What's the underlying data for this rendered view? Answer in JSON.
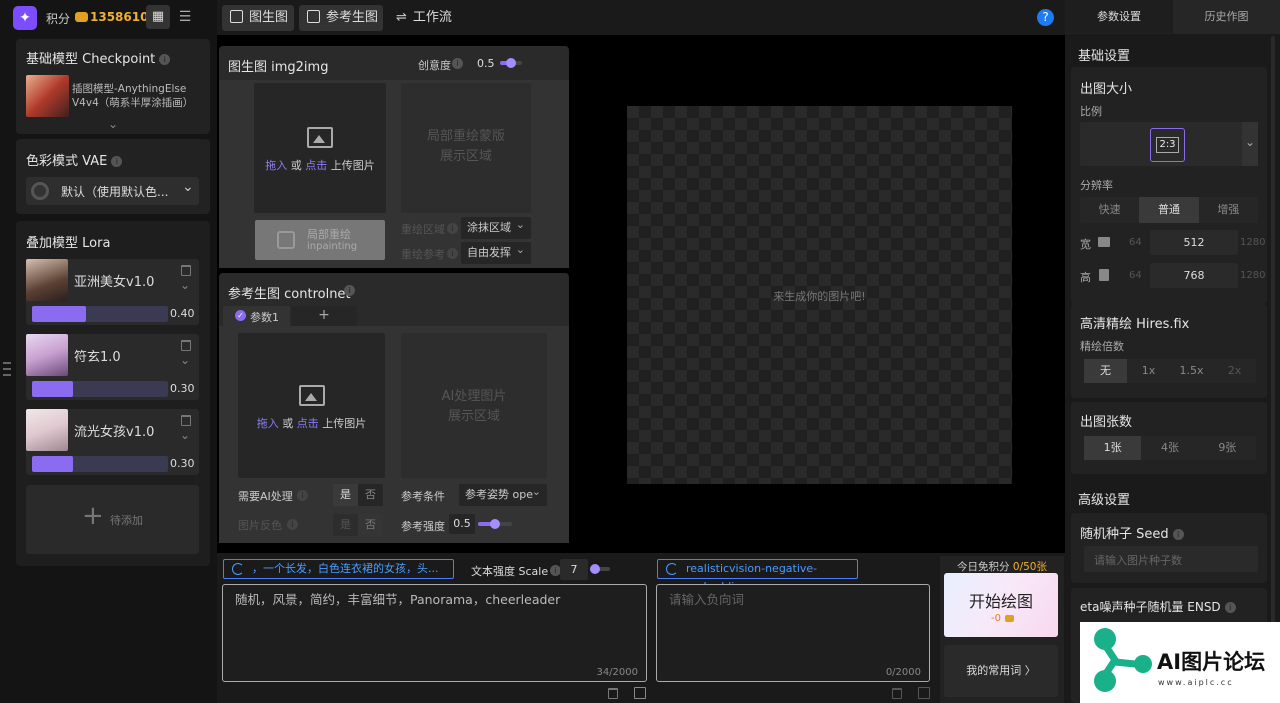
{
  "account": {
    "points_label": "积分",
    "points_value": "1358610"
  },
  "left": {
    "checkpoint_title": "基础模型 Checkpoint",
    "checkpoint_name": "插图模型-AnythingElse V4v4（萌系半厚涂插画）",
    "vae_title": "色彩模式 VAE",
    "vae_value": "默认（使用默认色...",
    "lora_title": "叠加模型 Lora",
    "loras": [
      {
        "name": "亚洲美女v1.0",
        "value": "0.40",
        "weight": 0.4
      },
      {
        "name": "符玄1.0",
        "value": "0.30",
        "weight": 0.3
      },
      {
        "name": "流光女孩v1.0",
        "value": "0.30",
        "weight": 0.3
      }
    ],
    "add_label": "待添加"
  },
  "tabs": [
    {
      "label": "图生图"
    },
    {
      "label": "参考生图"
    },
    {
      "label": "工作流"
    }
  ],
  "img2img": {
    "title": "图生图 img2img",
    "creativity_label": "创意度",
    "creativity_value": "0.5",
    "creativity": 0.5,
    "upload_drag": "拖入",
    "upload_or": "或",
    "upload_click": "点击",
    "upload_rest": "上传图片",
    "mask_line1": "局部重绘蒙版",
    "mask_line2": "展示区域",
    "inpaint_label": "局部重绘",
    "inpaint_sub": "inpainting",
    "area_label": "重绘区域",
    "area_value": "涂抹区域",
    "ref_label": "重绘参考",
    "ref_value": "自由发挥"
  },
  "controlnet": {
    "title": "参考生图 controlnet",
    "param_tab": "参数1",
    "add_tab": "+",
    "upload_drag": "拖入",
    "upload_or": "或",
    "upload_click": "点击",
    "upload_rest": "上传图片",
    "ai_line1": "AI处理图片",
    "ai_line2": "展示区域",
    "need_ai_label": "需要AI处理",
    "yes": "是",
    "no": "否",
    "invert_label": "图片反色",
    "cond_label": "参考条件",
    "cond_value": "参考姿势 ope",
    "strength_label": "参考强度",
    "strength_value": "0.5",
    "strength": 0.5
  },
  "canvas": {
    "placeholder": "来生成你的图片吧!"
  },
  "prompt": {
    "tag": "，一个长发，白色连衣裙的女孩，头...",
    "scale_label": "文本强度 Scale",
    "scale_value": "7",
    "scale": 0.25,
    "text": "随机，风景，简约，丰富细节，Panorama，cheerleader",
    "count": "34/2000"
  },
  "negative": {
    "tag": "realisticvision-negative-embedding",
    "placeholder": "请输入负向词",
    "count": "0/2000"
  },
  "generate": {
    "free_label": "今日免积分",
    "free_used": "0",
    "free_total": "/50张",
    "button": "开始绘图",
    "cost": "-0",
    "common_words": "我的常用词 〉"
  },
  "right": {
    "tab_params": "参数设置",
    "tab_history": "历史作图",
    "basic": "基础设置",
    "size_title": "出图大小",
    "ratio_label": "比例",
    "ratio_value": "2:3",
    "res_label": "分辨率",
    "res_options": [
      "快速",
      "普通",
      "增强"
    ],
    "width_label": "宽",
    "width_min": "64",
    "width_value": "512",
    "width_max": "1280",
    "height_label": "高",
    "height_min": "64",
    "height_value": "768",
    "height_max": "1280",
    "hires_title": "高清精绘 Hires.fix",
    "hires_label": "精绘倍数",
    "hires_options": [
      "无",
      "1x",
      "1.5x",
      "2x"
    ],
    "count_title": "出图张数",
    "count_options": [
      "1张",
      "4张",
      "9张"
    ],
    "advanced": "高级设置",
    "seed_title": "随机种子 Seed",
    "seed_placeholder": "请输入图片种子数",
    "ensd_title": "eta噪声种子随机量 ENSD"
  },
  "watermark": {
    "text": "AI图片论坛",
    "url": "www.aiplc.cc"
  },
  "colors": {
    "accent": "#8b6cf0",
    "link": "#4a9cff",
    "help": "#1e7cf2"
  }
}
